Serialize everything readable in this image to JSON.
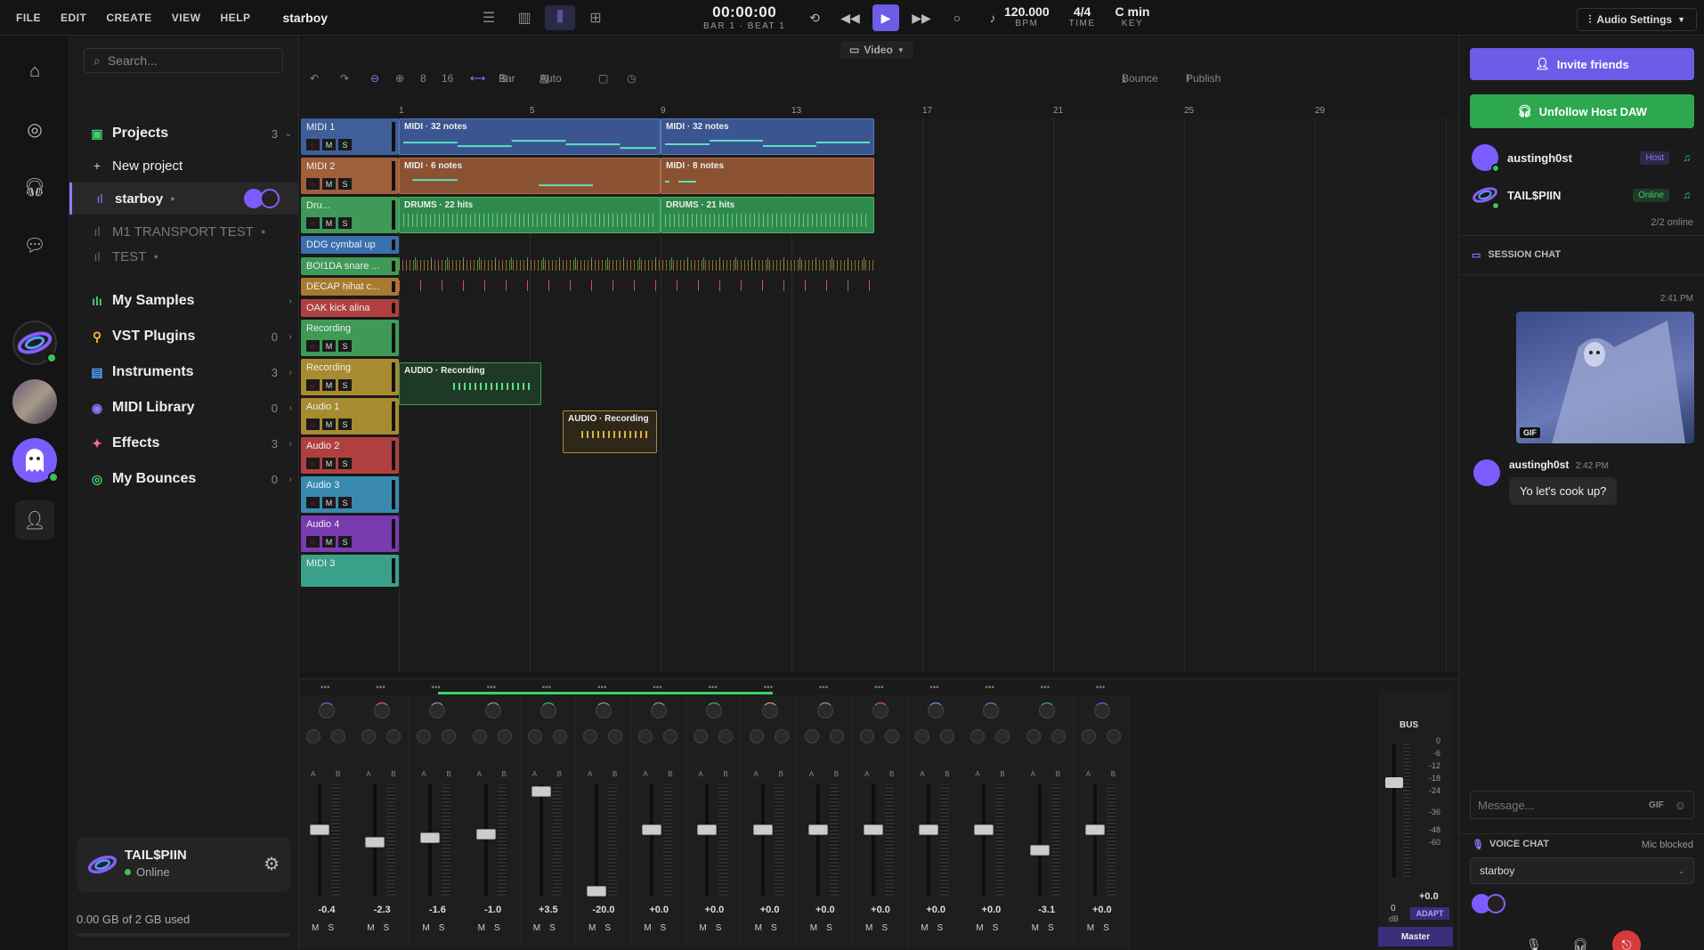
{
  "menu": [
    "FILE",
    "EDIT",
    "CREATE",
    "VIEW",
    "HELP"
  ],
  "project_title": "starboy",
  "transport": {
    "time": "00:00:00",
    "position": "BAR 1 · BEAT 1",
    "bpm": "120.000",
    "bpm_label": "BPM",
    "time_sig": "4/4",
    "time_sig_label": "TIME",
    "key": "C min",
    "key_label": "KEY"
  },
  "audio_settings": "Audio Settings",
  "video_label": "Video",
  "toolbar": {
    "zoom_a": "8",
    "zoom_b": "16",
    "snap": "Bar",
    "auto": "Auto",
    "bounce": "Bounce",
    "publish": "Publish"
  },
  "ruler": [
    "1",
    "5",
    "9",
    "13",
    "17",
    "21",
    "25",
    "29"
  ],
  "sidebar": {
    "search_placeholder": "Search...",
    "projects": {
      "label": "Projects",
      "count": "3"
    },
    "new_project": "New project",
    "project_items": [
      "starboy",
      "M1 TRANSPORT TEST",
      "TEST"
    ],
    "sections": [
      {
        "label": "My Samples",
        "count": ""
      },
      {
        "label": "VST Plugins",
        "count": "0"
      },
      {
        "label": "Instruments",
        "count": "3"
      },
      {
        "label": "MIDI Library",
        "count": "0"
      },
      {
        "label": "Effects",
        "count": "3"
      },
      {
        "label": "My Bounces",
        "count": "0"
      }
    ],
    "profile": {
      "name": "TAIL$PIIN",
      "status": "Online"
    },
    "storage": "0.00 GB of 2 GB used"
  },
  "tracks": [
    {
      "name": "MIDI 1",
      "color": "#3f5f9a"
    },
    {
      "name": "MIDI 2",
      "color": "#a0603a"
    },
    {
      "name": "Dru...",
      "color": "#3e9a56"
    },
    {
      "name": "DDG cymbal up",
      "color": "#3a6fb0"
    },
    {
      "name": "BOI1DA snare ...",
      "color": "#3e9a56"
    },
    {
      "name": "DECAP hihat c...",
      "color": "#a87a30"
    },
    {
      "name": "OAK kick alina",
      "color": "#b04040"
    },
    {
      "name": "Recording",
      "color": "#3e9a56"
    },
    {
      "name": "Recording",
      "color": "#a88a30"
    },
    {
      "name": "Audio 1",
      "color": "#a88a30"
    },
    {
      "name": "Audio 2",
      "color": "#b04040"
    },
    {
      "name": "Audio 3",
      "color": "#3a8ab0"
    },
    {
      "name": "Audio 4",
      "color": "#7a3ab0"
    },
    {
      "name": "MIDI 3",
      "color": "#3aa08a"
    }
  ],
  "clips": {
    "midi1_a": "MIDI · 32 notes",
    "midi1_b": "MIDI · 32 notes",
    "midi2_a": "MIDI · 6 notes",
    "midi2_b": "MIDI · 8 notes",
    "drums_a": "DRUMS · 22 hits",
    "drums_b": "DRUMS · 21 hits",
    "audio_a": "AUDIO · Recording",
    "audio_b": "AUDIO · Recording"
  },
  "mixer": {
    "values": [
      "-0.4",
      "-2.3",
      "-1.6",
      "-1.0",
      "+3.5",
      "-20.0",
      "+0.0",
      "+0.0",
      "+0.0",
      "+0.0",
      "+0.0",
      "+0.0",
      "+0.0",
      "-3.1",
      "+0.0"
    ],
    "fader_levels": [
      0.62,
      0.5,
      0.54,
      0.58,
      0.98,
      0.03,
      0.62,
      0.62,
      0.62,
      0.62,
      0.62,
      0.62,
      0.62,
      0.42,
      0.62
    ],
    "knob_colors": [
      "#6a7cff",
      "#ff6a5a",
      "#aaa",
      "#aaa",
      "#3ecf6e",
      "#aaa",
      "#aaa",
      "#3ecf6e",
      "#ffb83e",
      "#aaa",
      "#ff5a5a",
      "#6ab0ff",
      "#9a6aff",
      "#3ecf6e",
      "#6a7cff"
    ],
    "bus_label": "BUS",
    "bus_scale": [
      "0",
      "-6",
      "-12",
      "-18",
      "-24",
      "-36",
      "-48",
      "-60"
    ],
    "bus_value": "+0.0",
    "bus_zero": "0",
    "bus_db": "dB",
    "adapt": "ADAPT",
    "master": "Master",
    "mute": "M",
    "solo": "S",
    "a": "A",
    "b": "B"
  },
  "right": {
    "invite": "Invite friends",
    "unfollow": "Unfollow Host DAW",
    "users": [
      {
        "name": "austingh0st",
        "badge": "Host"
      },
      {
        "name": "TAIL$PIIN",
        "badge": "Online"
      }
    ],
    "online": "2/2 online",
    "chat_header": "SESSION CHAT",
    "gif_time": "2:41 PM",
    "gif_label": "GIF",
    "msg_user": "austingh0st",
    "msg_time": "2:42 PM",
    "msg_text": "Yo let's cook up?",
    "msg_placeholder": "Message...",
    "gif_btn": "GIF",
    "voice_header": "VOICE CHAT",
    "mic_blocked": "Mic blocked",
    "voice_channel": "starboy"
  }
}
